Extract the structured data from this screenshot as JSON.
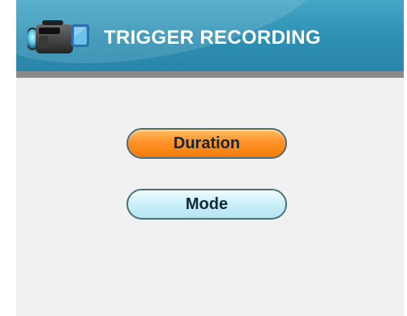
{
  "header": {
    "title": "TRIGGER RECORDING",
    "icon": "video-camera-icon",
    "background_color": "#2d8fb2"
  },
  "menu": {
    "items": [
      {
        "label": "Duration",
        "selected": true,
        "color": "#ff9329"
      },
      {
        "label": "Mode",
        "selected": false,
        "color": "#cbeff8"
      }
    ]
  }
}
